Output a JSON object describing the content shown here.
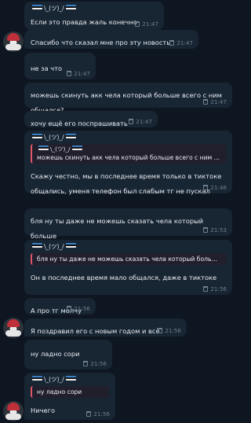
{
  "sender": {
    "name_left": "══̲̲͞╲_(ツ)_╱̲͞══",
    "name_right": ""
  },
  "messages": [
    {
      "text": "Если это правда жаль конечно",
      "time": "21:47"
    },
    {
      "text": "Спасибо что сказал мне про эту новость",
      "time": "21:47"
    },
    {
      "text": "не за что",
      "time": "21:47"
    },
    {
      "text": "можешь скинуть акк чела который больше всего с ним\nобщался?",
      "time": "21:47"
    },
    {
      "text": "хочу ещё его поспрашивать",
      "time": "21:47"
    },
    {
      "reply_text": "можешь скинуть акк чела который больше всего с ним ...",
      "text": "Скажу честно, мы в последнее время только в тиктоке\nобщались, уменя телефон был слабым тг не пускал",
      "time": "21:48"
    },
    {
      "text": "бля ну ты даже не можешь сказать чела который больше\nвсех с ним в тг общался?",
      "time": "21:53"
    },
    {
      "reply_text": "бля ну ты даже не можешь сказать чела который больш...",
      "text": "Он в последнее время мало общался, даже в тиктоке",
      "time": "21:56"
    },
    {
      "text": "А про тг молчу",
      "time": "21:56"
    },
    {
      "text": "Я поздравил его с новым годом и всё",
      "time": "21:56"
    },
    {
      "text": "ну ладно сори",
      "time": "21:56"
    },
    {
      "reply_text": "ну ладно сори",
      "text": "Ничего",
      "time": "21:56"
    }
  ]
}
